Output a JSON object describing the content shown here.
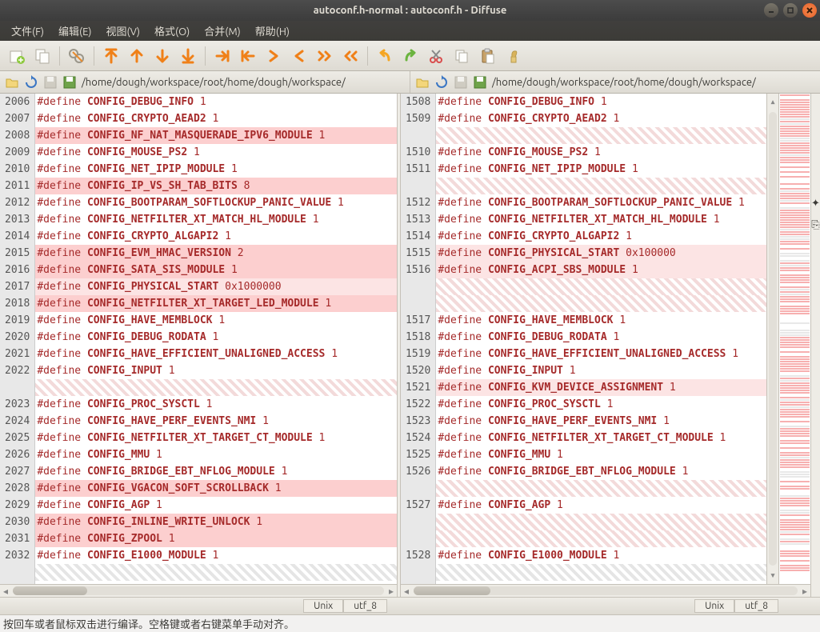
{
  "title": "autoconf.h-normal : autoconf.h - Diffuse",
  "menus": [
    "文件(F)",
    "编辑(E)",
    "视图(V)",
    "格式(O)",
    "合并(M)",
    "帮助(H)"
  ],
  "path_left": "/home/dough/workspace/root/home/dough/workspace/",
  "path_right": "/home/dough/workspace/root/home/dough/workspace/",
  "status": {
    "encoding": "utf_8",
    "eol": "Unix"
  },
  "bottom_hint": "按回车或者鼠标双击进行编译。空格键或者右键菜单手动对齐。",
  "left_lines": [
    {
      "n": 2006,
      "def": "#define",
      "sym": "CONFIG_DEBUG_INFO",
      "val": "1",
      "cls": ""
    },
    {
      "n": 2007,
      "def": "#define",
      "sym": "CONFIG_CRYPTO_AEAD2",
      "val": "1",
      "cls": ""
    },
    {
      "n": 2008,
      "def": "#define",
      "sym": "CONFIG_NF_NAT_MASQUERADE_IPV6_MODULE",
      "val": "1",
      "cls": "hl-del"
    },
    {
      "n": 2009,
      "def": "#define",
      "sym": "CONFIG_MOUSE_PS2",
      "val": "1",
      "cls": ""
    },
    {
      "n": 2010,
      "def": "#define",
      "sym": "CONFIG_NET_IPIP_MODULE",
      "val": "1",
      "cls": ""
    },
    {
      "n": 2011,
      "def": "#define",
      "sym": "CONFIG_IP_VS_SH_TAB_BITS",
      "val": "8",
      "cls": "hl-del"
    },
    {
      "n": 2012,
      "def": "#define",
      "sym": "CONFIG_BOOTPARAM_SOFTLOCKUP_PANIC_VALUE",
      "val": "1",
      "cls": ""
    },
    {
      "n": 2013,
      "def": "#define",
      "sym": "CONFIG_NETFILTER_XT_MATCH_HL_MODULE",
      "val": "1",
      "cls": ""
    },
    {
      "n": 2014,
      "def": "#define",
      "sym": "CONFIG_CRYPTO_ALGAPI2",
      "val": "1",
      "cls": ""
    },
    {
      "n": 2015,
      "def": "#define",
      "sym": "CONFIG_EVM_HMAC_VERSION",
      "val": "2",
      "cls": "hl-del"
    },
    {
      "n": 2016,
      "def": "#define",
      "sym": "CONFIG_SATA_SIS_MODULE",
      "val": "1",
      "cls": "hl-del"
    },
    {
      "n": 2017,
      "def": "#define",
      "sym": "CONFIG_PHYSICAL_START",
      "val": "0x1000000",
      "cls": "hl-mod"
    },
    {
      "n": 2018,
      "def": "#define",
      "sym": "CONFIG_NETFILTER_XT_TARGET_LED_MODULE",
      "val": "1",
      "cls": "hl-del"
    },
    {
      "n": 2019,
      "def": "#define",
      "sym": "CONFIG_HAVE_MEMBLOCK",
      "val": "1",
      "cls": ""
    },
    {
      "n": 2020,
      "def": "#define",
      "sym": "CONFIG_DEBUG_RODATA",
      "val": "1",
      "cls": ""
    },
    {
      "n": 2021,
      "def": "#define",
      "sym": "CONFIG_HAVE_EFFICIENT_UNALIGNED_ACCESS",
      "val": "1",
      "cls": ""
    },
    {
      "n": 2022,
      "def": "#define",
      "sym": "CONFIG_INPUT",
      "val": "1",
      "cls": ""
    },
    {
      "n": "",
      "def": "",
      "sym": "",
      "val": "",
      "cls": "hl-hatch"
    },
    {
      "n": 2023,
      "def": "#define",
      "sym": "CONFIG_PROC_SYSCTL",
      "val": "1",
      "cls": ""
    },
    {
      "n": 2024,
      "def": "#define",
      "sym": "CONFIG_HAVE_PERF_EVENTS_NMI",
      "val": "1",
      "cls": ""
    },
    {
      "n": 2025,
      "def": "#define",
      "sym": "CONFIG_NETFILTER_XT_TARGET_CT_MODULE",
      "val": "1",
      "cls": ""
    },
    {
      "n": 2026,
      "def": "#define",
      "sym": "CONFIG_MMU",
      "val": "1",
      "cls": ""
    },
    {
      "n": 2027,
      "def": "#define",
      "sym": "CONFIG_BRIDGE_EBT_NFLOG_MODULE",
      "val": "1",
      "cls": ""
    },
    {
      "n": 2028,
      "def": "#define",
      "sym": "CONFIG_VGACON_SOFT_SCROLLBACK",
      "val": "1",
      "cls": "hl-del"
    },
    {
      "n": 2029,
      "def": "#define",
      "sym": "CONFIG_AGP",
      "val": "1",
      "cls": ""
    },
    {
      "n": 2030,
      "def": "#define",
      "sym": "CONFIG_INLINE_WRITE_UNLOCK",
      "val": "1",
      "cls": "hl-del"
    },
    {
      "n": 2031,
      "def": "#define",
      "sym": "CONFIG_ZPOOL",
      "val": "1",
      "cls": "hl-del"
    },
    {
      "n": 2032,
      "def": "#define",
      "sym": "CONFIG_E1000_MODULE",
      "val": "1",
      "cls": ""
    },
    {
      "n": "",
      "def": "",
      "sym": "",
      "val": "",
      "cls": "hl-hatch-gray"
    }
  ],
  "right_lines": [
    {
      "n": 1508,
      "def": "#define",
      "sym": "CONFIG_DEBUG_INFO",
      "val": "1",
      "cls": ""
    },
    {
      "n": 1509,
      "def": "#define",
      "sym": "CONFIG_CRYPTO_AEAD2",
      "val": "1",
      "cls": ""
    },
    {
      "n": "",
      "def": "",
      "sym": "",
      "val": "",
      "cls": "hl-hatch"
    },
    {
      "n": 1510,
      "def": "#define",
      "sym": "CONFIG_MOUSE_PS2",
      "val": "1",
      "cls": ""
    },
    {
      "n": 1511,
      "def": "#define",
      "sym": "CONFIG_NET_IPIP_MODULE",
      "val": "1",
      "cls": ""
    },
    {
      "n": "",
      "def": "",
      "sym": "",
      "val": "",
      "cls": "hl-hatch"
    },
    {
      "n": 1512,
      "def": "#define",
      "sym": "CONFIG_BOOTPARAM_SOFTLOCKUP_PANIC_VALUE",
      "val": "1",
      "cls": ""
    },
    {
      "n": 1513,
      "def": "#define",
      "sym": "CONFIG_NETFILTER_XT_MATCH_HL_MODULE",
      "val": "1",
      "cls": ""
    },
    {
      "n": 1514,
      "def": "#define",
      "sym": "CONFIG_CRYPTO_ALGAPI2",
      "val": "1",
      "cls": ""
    },
    {
      "n": 1515,
      "def": "#define",
      "sym": "CONFIG_PHYSICAL_START",
      "val": "0x100000",
      "cls": "hl-mod"
    },
    {
      "n": 1516,
      "def": "#define",
      "sym": "CONFIG_ACPI_SBS_MODULE",
      "val": "1",
      "cls": "hl-mod"
    },
    {
      "n": "",
      "def": "",
      "sym": "",
      "val": "",
      "cls": "hl-hatch"
    },
    {
      "n": "",
      "def": "",
      "sym": "",
      "val": "",
      "cls": "hl-hatch"
    },
    {
      "n": 1517,
      "def": "#define",
      "sym": "CONFIG_HAVE_MEMBLOCK",
      "val": "1",
      "cls": ""
    },
    {
      "n": 1518,
      "def": "#define",
      "sym": "CONFIG_DEBUG_RODATA",
      "val": "1",
      "cls": ""
    },
    {
      "n": 1519,
      "def": "#define",
      "sym": "CONFIG_HAVE_EFFICIENT_UNALIGNED_ACCESS",
      "val": "1",
      "cls": ""
    },
    {
      "n": 1520,
      "def": "#define",
      "sym": "CONFIG_INPUT",
      "val": "1",
      "cls": ""
    },
    {
      "n": 1521,
      "def": "#define",
      "sym": "CONFIG_KVM_DEVICE_ASSIGNMENT",
      "val": "1",
      "cls": "hl-mod"
    },
    {
      "n": 1522,
      "def": "#define",
      "sym": "CONFIG_PROC_SYSCTL",
      "val": "1",
      "cls": ""
    },
    {
      "n": 1523,
      "def": "#define",
      "sym": "CONFIG_HAVE_PERF_EVENTS_NMI",
      "val": "1",
      "cls": ""
    },
    {
      "n": 1524,
      "def": "#define",
      "sym": "CONFIG_NETFILTER_XT_TARGET_CT_MODULE",
      "val": "1",
      "cls": ""
    },
    {
      "n": 1525,
      "def": "#define",
      "sym": "CONFIG_MMU",
      "val": "1",
      "cls": ""
    },
    {
      "n": 1526,
      "def": "#define",
      "sym": "CONFIG_BRIDGE_EBT_NFLOG_MODULE",
      "val": "1",
      "cls": ""
    },
    {
      "n": "",
      "def": "",
      "sym": "",
      "val": "",
      "cls": "hl-hatch"
    },
    {
      "n": 1527,
      "def": "#define",
      "sym": "CONFIG_AGP",
      "val": "1",
      "cls": ""
    },
    {
      "n": "",
      "def": "",
      "sym": "",
      "val": "",
      "cls": "hl-hatch"
    },
    {
      "n": "",
      "def": "",
      "sym": "",
      "val": "",
      "cls": "hl-hatch"
    },
    {
      "n": 1528,
      "def": "#define",
      "sym": "CONFIG_E1000_MODULE",
      "val": "1",
      "cls": ""
    },
    {
      "n": "",
      "def": "",
      "sym": "",
      "val": "",
      "cls": "hl-hatch-gray"
    }
  ]
}
